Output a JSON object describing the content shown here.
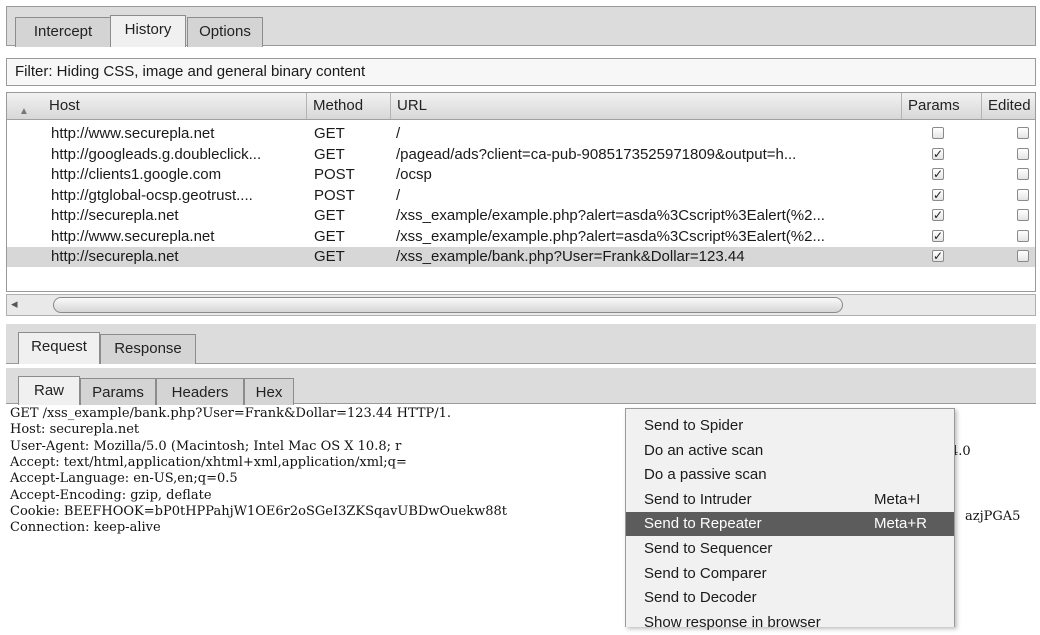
{
  "top_tabs": [
    "Intercept",
    "History",
    "Options"
  ],
  "filter_text": "Filter: Hiding CSS, image and general binary content",
  "table": {
    "headers": {
      "host": "Host",
      "method": "Method",
      "url": "URL",
      "params": "Params",
      "edited": "Edited"
    },
    "rows": [
      {
        "host": "http://www.securepla.net",
        "method": "GET",
        "url": "/",
        "params": false,
        "edited": false
      },
      {
        "host": "http://googleads.g.doubleclick...",
        "method": "GET",
        "url": "/pagead/ads?client=ca-pub-9085173525971809&output=h...",
        "params": true,
        "edited": false
      },
      {
        "host": "http://clients1.google.com",
        "method": "POST",
        "url": "/ocsp",
        "params": true,
        "edited": false
      },
      {
        "host": "http://gtglobal-ocsp.geotrust....",
        "method": "POST",
        "url": "/",
        "params": true,
        "edited": false
      },
      {
        "host": "http://securepla.net",
        "method": "GET",
        "url": "/xss_example/example.php?alert=asda%3Cscript%3Ealert(%2...",
        "params": true,
        "edited": false
      },
      {
        "host": "http://www.securepla.net",
        "method": "GET",
        "url": "/xss_example/example.php?alert=asda%3Cscript%3Ealert(%2...",
        "params": true,
        "edited": false
      },
      {
        "host": "http://securepla.net",
        "method": "GET",
        "url": "/xss_example/bank.php?User=Frank&Dollar=123.44",
        "params": true,
        "edited": false
      }
    ],
    "selected_row": 6
  },
  "rr_tabs": [
    "Request",
    "Response"
  ],
  "sub_tabs": [
    "Raw",
    "Params",
    "Headers",
    "Hex"
  ],
  "request_lines": [
    "GET /xss_example/bank.php?User=Frank&Dollar=123.44 HTTP/1.",
    "Host: securepla.net",
    "User-Agent: Mozilla/5.0 (Macintosh; Intel Mac OS X 10.8; r",
    "Accept: text/html,application/xhtml+xml,application/xml;q=",
    "Accept-Language: en-US,en;q=0.5",
    "Accept-Encoding: gzip, deflate",
    "Cookie: BEEFHOOK=bP0tHPPahjW1OE6r2oSGeI3ZKSqavUBDwOuekw88t",
    "Connection: keep-alive"
  ],
  "request_tail": {
    "line3": "4.0",
    "line7": "azjPGA5"
  },
  "context_menu": {
    "items": [
      {
        "label": "Send to Spider",
        "shortcut": ""
      },
      {
        "label": "Do an active scan",
        "shortcut": ""
      },
      {
        "label": "Do a passive scan",
        "shortcut": ""
      },
      {
        "label": "Send to Intruder",
        "shortcut": "Meta+I"
      },
      {
        "label": "Send to Repeater",
        "shortcut": "Meta+R"
      },
      {
        "label": "Send to Sequencer",
        "shortcut": ""
      },
      {
        "label": "Send to Comparer",
        "shortcut": ""
      },
      {
        "label": "Send to Decoder",
        "shortcut": ""
      },
      {
        "label": "Show response in browser",
        "shortcut": ""
      }
    ],
    "highlighted": 4
  },
  "colors": {
    "highlight": "#5c5c5c",
    "selected_row": "#d7d7d7"
  }
}
